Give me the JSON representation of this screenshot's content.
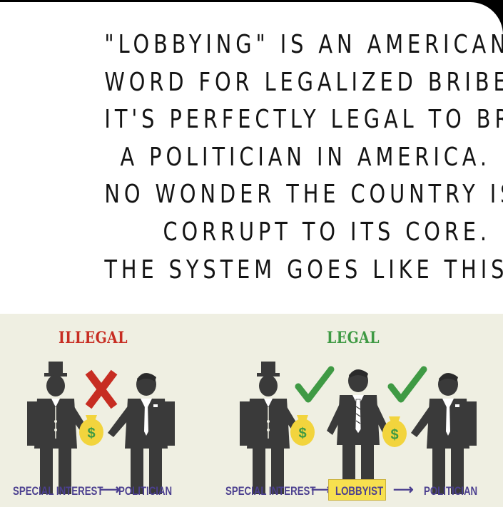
{
  "quote": {
    "lines": [
      "\"LOBBYING\" IS AN AMERICAN",
      "WORD FOR LEGALIZED BRIBERY.",
      "IT'S PERFECTLY LEGAL TO BRIBE",
      "A POLITICIAN IN AMERICA.",
      "NO WONDER THE COUNTRY IS",
      "CORRUPT TO ITS CORE.",
      "THE SYSTEM GOES LIKE THIS:"
    ]
  },
  "illustration": {
    "illegal_label": "ILLEGAL",
    "legal_label": "LEGAL",
    "left_caption": {
      "special_interest": "SPECIAL INTEREST",
      "arrow": "⟶",
      "politician": "POLITICIAN"
    },
    "right_caption": {
      "special_interest": "SPECIAL INTEREST",
      "arrow1": "⟶",
      "lobbyist": "LOBBYIST",
      "arrow2": "⟶",
      "politician": "POLITICIAN"
    },
    "money_symbol": "$",
    "colors": {
      "background": "#efefe2",
      "figure": "#3a3a3a",
      "illegal": "#c72d22",
      "legal": "#3f9a44",
      "money_bag": "#f2d43d",
      "caption": "#4b3f8f",
      "lobbyist_box": "#f7e04f"
    }
  }
}
